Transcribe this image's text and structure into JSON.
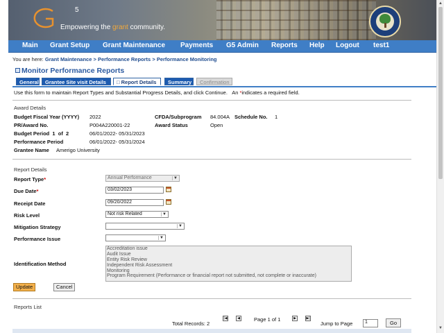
{
  "banner": {
    "logo_letter": "G",
    "logo_superscript": "5",
    "tagline_before": "Empowering the ",
    "tagline_highlight": "grant",
    "tagline_after": " community."
  },
  "nav": [
    "Main",
    "Grant Setup",
    "Grant Maintenance",
    "Payments",
    "G5 Admin",
    "Reports",
    "Help",
    "Logout",
    "test1"
  ],
  "breadcrumb": {
    "prefix": "You are here:",
    "items": [
      "Grant Maintenance",
      "Performance Reports",
      "Performance Monitoring"
    ],
    "separator": ">"
  },
  "page_title": "Monitor Performance Reports",
  "tabs": [
    {
      "label": "General",
      "state": "normal"
    },
    {
      "label": "Grantee Site visit Details",
      "state": "normal"
    },
    {
      "label": "□ Report Details",
      "state": "active"
    },
    {
      "label": "Summary",
      "state": "normal"
    },
    {
      "label": "Confirmation",
      "state": "disabled"
    }
  ],
  "instructions": {
    "text": "Use this form to maintain Report Types and Substantial Progress Details, and click Continue.",
    "req_prefix": "An ",
    "req_star": "*",
    "req_suffix": "indicates a required field."
  },
  "award": {
    "section_label": "Award Details",
    "budget_fiscal_year_label": "Budget Fiscal Year (YYYY)",
    "budget_fiscal_year": "2022",
    "pr_award_label": "PR/Award No.",
    "pr_award": "P004A220001-22",
    "budget_period_label": "Budget Period  1  of  2",
    "budget_period": "06/01/2022- 05/31/2023",
    "performance_period_label": "Performance Period",
    "performance_period": "06/01/2022- 05/31/2024",
    "grantee_name_label": "Grantee Name",
    "grantee_name": "Amerigo University",
    "cfda_label": "CFDA/Subprogram",
    "cfda": "84.004A",
    "schedule_label": "Schedule No.",
    "schedule": "1",
    "award_status_label": "Award Status",
    "award_status": "Open"
  },
  "report": {
    "section_label": "Report Details",
    "report_type_label": "Report Type",
    "report_type": "Annual Performance",
    "due_date_label": "Due Date",
    "due_date": "03/02/2023",
    "receipt_date_label": "Receipt Date",
    "receipt_date": "09/20/2022",
    "risk_level_label": "Risk Level",
    "risk_level": "Not risk Related",
    "mitigation_label": "Mitigation Strategy",
    "mitigation": "",
    "performance_issue_label": "Performance Issue",
    "performance_issue": "",
    "identification_label": "Identification Method",
    "identification_options": [
      "Accreditation issue",
      "Audit Issue",
      "Entity Risk Review",
      "Independent Risk Assessment",
      "Monitoring",
      "Program Requirement (Performance or financial report not submitted, not complete or inaccurate)"
    ],
    "required_star": "*"
  },
  "buttons": {
    "update": "Update",
    "cancel": "Cancel"
  },
  "reports_list": {
    "label": "Reports List",
    "total_records": "Total Records: 2",
    "page_info": "Page 1 of 1",
    "jump_label": "Jump to Page",
    "jump_value": "1",
    "go": "Go"
  },
  "colors": {
    "nav_bg": "#3f7ec6",
    "title_blue": "#2b5aa0",
    "accent_orange": "#f3b04b",
    "required_red": "#cc0000"
  }
}
